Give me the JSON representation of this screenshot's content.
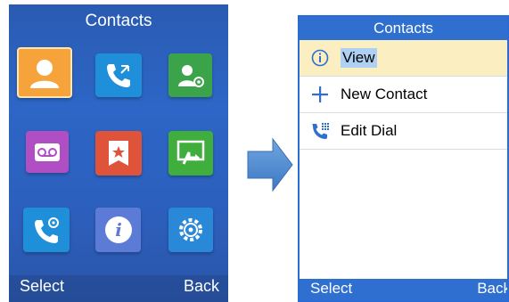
{
  "left_screen": {
    "title": "Contacts",
    "softkeys": {
      "left": "Select",
      "right": "Back"
    },
    "icons": [
      {
        "name": "contacts-icon",
        "color": "#f5a33a"
      },
      {
        "name": "call-history-icon",
        "color": "#1e8fd8"
      },
      {
        "name": "contact-settings-icon",
        "color": "#3ba34a"
      },
      {
        "name": "voicemail-icon",
        "color": "#b04fc4"
      },
      {
        "name": "favorites-icon",
        "color": "#e0533b"
      },
      {
        "name": "transfer-icon",
        "color": "#3fae3c"
      },
      {
        "name": "call-settings-icon",
        "color": "#1e8fd8"
      },
      {
        "name": "info-icon",
        "color": "#5b7bd6"
      },
      {
        "name": "settings-gear-icon",
        "color": "#2a88d8"
      }
    ]
  },
  "right_screen": {
    "title": "Contacts",
    "menu": [
      {
        "label": "View",
        "icon": "info-circle-icon",
        "selected": true
      },
      {
        "label": "New Contact",
        "icon": "plus-icon",
        "selected": false
      },
      {
        "label": "Edit Dial",
        "icon": "phone-dialpad-icon",
        "selected": false
      }
    ],
    "softkeys": {
      "left": "Select",
      "right": "Back"
    }
  }
}
